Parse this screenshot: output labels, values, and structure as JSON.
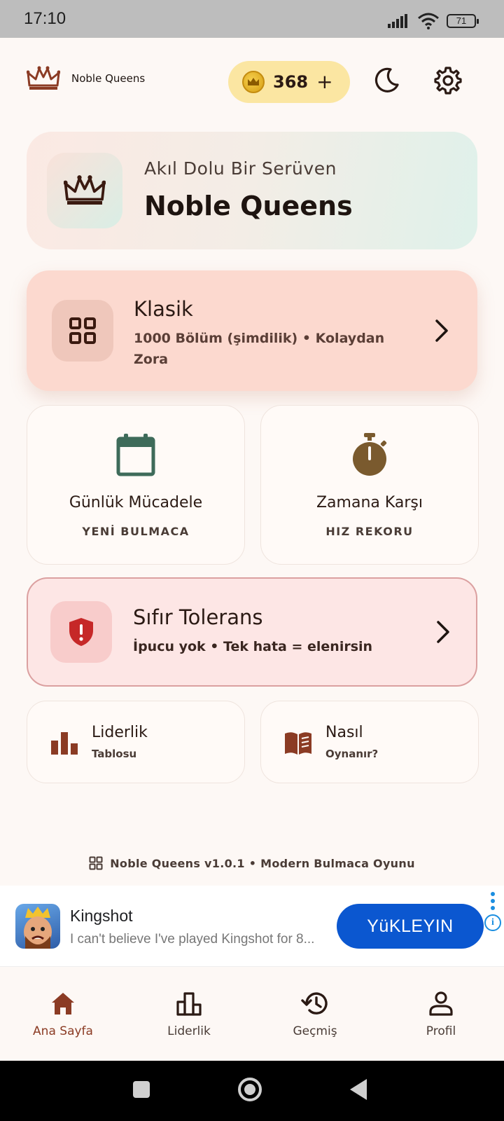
{
  "status_bar": {
    "time": "17:10",
    "battery": "71"
  },
  "header": {
    "brand_name": "Noble Queens",
    "coins": "368",
    "coin_plus": "+"
  },
  "hero": {
    "subtitle": "Akıl Dolu Bir Serüven",
    "title": "Noble Queens"
  },
  "modes": {
    "classic": {
      "title": "Klasik",
      "description": "1000 Bölüm (şimdilik) • Kolaydan Zora"
    },
    "daily": {
      "title": "Günlük Mücadele",
      "subtitle": "YENİ BULMACA"
    },
    "timed": {
      "title": "Zamana Karşı",
      "subtitle": "HIZ REKORU"
    },
    "zero_tolerance": {
      "title": "Sıfır Tolerans",
      "description": "İpucu yok • Tek hata = elenirsin"
    }
  },
  "links": {
    "leaderboard": {
      "title": "Liderlik",
      "subtitle": "Tablosu"
    },
    "how_to": {
      "title": "Nasıl",
      "subtitle": "Oynanır?"
    }
  },
  "footer": {
    "version_text": "Noble Queens v1.0.1 • Modern Bulmaca Oyunu"
  },
  "ad": {
    "title": "Kingshot",
    "text": "I can't believe I've played Kingshot for 8...",
    "cta": "YüKLEYIN",
    "info": "i"
  },
  "bottom_nav": [
    {
      "label": "Ana Sayfa",
      "icon": "home-icon",
      "active": true
    },
    {
      "label": "Liderlik",
      "icon": "leaderboard-icon",
      "active": false
    },
    {
      "label": "Geçmiş",
      "icon": "history-icon",
      "active": false
    },
    {
      "label": "Profil",
      "icon": "profile-icon",
      "active": false
    }
  ],
  "colors": {
    "accent": "#8b3b24",
    "classic_card": "#fcd9cf",
    "zero_card": "#fde6e5",
    "coin_pill": "#fbe6a2",
    "calendar_icon": "#3e6b5a",
    "stopwatch_icon": "#7a5a2e",
    "shield_icon": "#c62828",
    "ad_button": "#0b57d0"
  }
}
